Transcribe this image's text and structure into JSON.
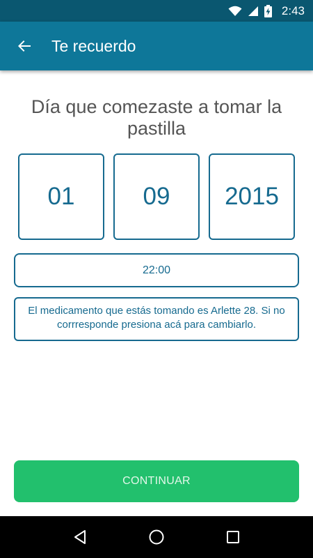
{
  "status_bar": {
    "time": "2:43",
    "icons": [
      "wifi-icon",
      "signal-icon",
      "battery-charging-icon"
    ]
  },
  "app_bar": {
    "title": "Te recuerdo",
    "back_icon": "arrow-left-icon"
  },
  "main": {
    "question": "Día que comezaste a tomar la pastilla",
    "date": {
      "day": "01",
      "month": "09",
      "year": "2015"
    },
    "time": "22:00",
    "medication_info": "El medicamento que estás tomando es Arlette 28. Si no corrresponde presiona acá para cambiarlo.",
    "continue_label": "CONTINUAR"
  },
  "nav_bar": {
    "icons": [
      "back-triangle-icon",
      "home-circle-icon",
      "recents-square-icon"
    ]
  },
  "colors": {
    "status_bar": "#0a5770",
    "app_bar": "#0e7799",
    "accent": "#166a8f",
    "button": "#22c06d",
    "text_gray": "#555555"
  }
}
